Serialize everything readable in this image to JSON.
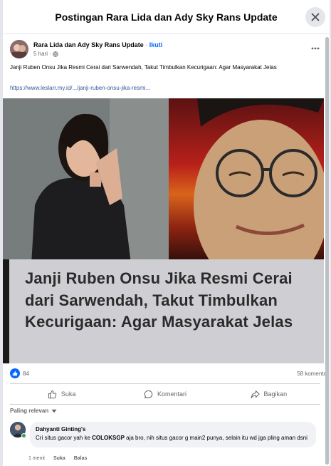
{
  "dialog": {
    "title": "Postingan Rara Lida dan Ady Sky Rans Update"
  },
  "post": {
    "author": "Rara Lida dan Ady Sky Rans Update",
    "separator": "·",
    "follow": "Ikuti",
    "time": "5 hari",
    "text": "Janji Ruben Onsu Jika Resmi Cerai dari Sarwendah, Takut Timbulkan Kecurigaan: Agar Masyarakat Jelas",
    "link": "https://www.leslarr.my.id/.../janji-ruben-onsu-jika-resmi...",
    "headline": "Janji Ruben Onsu Jika Resmi Cerai dari Sarwendah, Takut Timbulkan Kecurigaan: Agar Masyarakat Jelas"
  },
  "stats": {
    "likes": "84",
    "comments": "58 komenta"
  },
  "actions": {
    "like": "Suka",
    "comment": "Komentari",
    "share": "Bagikan"
  },
  "sort": {
    "label": "Paling relevan"
  },
  "comment": {
    "author": "Dahyanti Ginting's",
    "text_before": "Cri situs gacor yah ke ",
    "text_bold": "COLOKSGP",
    "text_after": " aja bro, nih situs gacor g main2 punya, selain itu wd jga pling aman dsni",
    "time": "1 menit",
    "like": "Suka",
    "reply": "Balas"
  },
  "colors": {
    "accent": "#0866ff",
    "link": "#385898",
    "muted": "#65676b",
    "bubble": "#f0f2f5"
  }
}
